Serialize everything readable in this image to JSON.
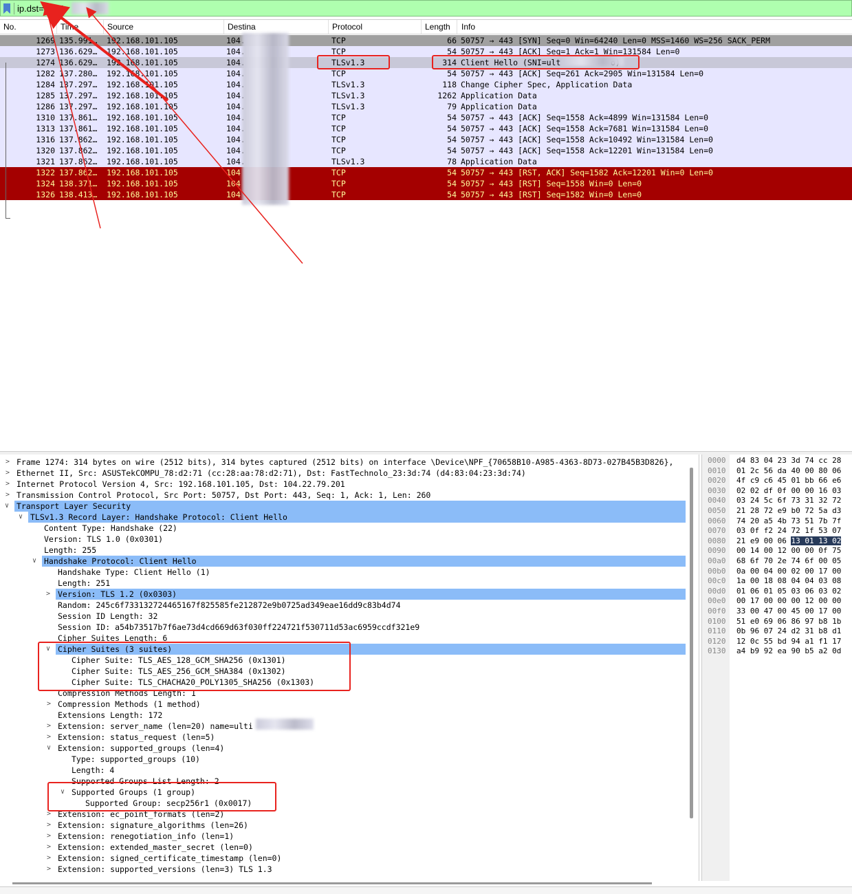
{
  "filter": {
    "text": "ip.dst==104."
  },
  "columns": {
    "no": "No.",
    "time": "Time",
    "source": "Source",
    "destination": "Destina",
    "protocol": "Protocol",
    "length": "Length",
    "info": "Info"
  },
  "packets": [
    {
      "no": "1269",
      "time": "135.991…",
      "src": "192.168.101.105",
      "dst": "104.",
      "proto": "TCP",
      "len": "66",
      "info": "50757 → 443 [SYN] Seq=0 Win=64240 Len=0 MSS=1460 WS=256 SACK_PERM",
      "style": "gray"
    },
    {
      "no": "1273",
      "time": "136.629…",
      "src": "192.168.101.105",
      "dst": "104.",
      "proto": "TCP",
      "len": "54",
      "info": "50757 → 443 [ACK] Seq=1 Ack=1 Win=131584 Len=0",
      "style": "lav"
    },
    {
      "no": "1274",
      "time": "136.629…",
      "src": "192.168.101.105",
      "dst": "104.",
      "proto": "TLSv1.3",
      "len": "314",
      "info": "Client Hello (SNI=ult",
      "info_tail": "o)",
      "style": "sel"
    },
    {
      "no": "1282",
      "time": "137.280…",
      "src": "192.168.101.105",
      "dst": "104.",
      "proto": "TCP",
      "len": "54",
      "info": "50757 → 443 [ACK] Seq=261 Ack=2905 Win=131584 Len=0",
      "style": "lav"
    },
    {
      "no": "1284",
      "time": "137.297…",
      "src": "192.168.101.105",
      "dst": "104.",
      "proto": "TLSv1.3",
      "len": "118",
      "info": "Change Cipher Spec, Application Data",
      "style": "lav"
    },
    {
      "no": "1285",
      "time": "137.297…",
      "src": "192.168.101.105",
      "dst": "104.",
      "proto": "TLSv1.3",
      "len": "1262",
      "info": "Application Data",
      "style": "lav"
    },
    {
      "no": "1286",
      "time": "137.297…",
      "src": "192.168.101.105",
      "dst": "104.",
      "proto": "TLSv1.3",
      "len": "79",
      "info": "Application Data",
      "style": "lav"
    },
    {
      "no": "1310",
      "time": "137.861…",
      "src": "192.168.101.105",
      "dst": "104.",
      "proto": "TCP",
      "len": "54",
      "info": "50757 → 443 [ACK] Seq=1558 Ack=4899 Win=131584 Len=0",
      "style": "lav"
    },
    {
      "no": "1313",
      "time": "137.861…",
      "src": "192.168.101.105",
      "dst": "104.",
      "proto": "TCP",
      "len": "54",
      "info": "50757 → 443 [ACK] Seq=1558 Ack=7681 Win=131584 Len=0",
      "style": "lav"
    },
    {
      "no": "1316",
      "time": "137.862…",
      "src": "192.168.101.105",
      "dst": "104.",
      "proto": "TCP",
      "len": "54",
      "info": "50757 → 443 [ACK] Seq=1558 Ack=10492 Win=131584 Len=0",
      "style": "lav"
    },
    {
      "no": "1320",
      "time": "137.862…",
      "src": "192.168.101.105",
      "dst": "104.",
      "proto": "TCP",
      "len": "54",
      "info": "50757 → 443 [ACK] Seq=1558 Ack=12201 Win=131584 Len=0",
      "style": "lav"
    },
    {
      "no": "1321",
      "time": "137.862…",
      "src": "192.168.101.105",
      "dst": "104.",
      "proto": "TLSv1.3",
      "len": "78",
      "info": "Application Data",
      "style": "lav"
    },
    {
      "no": "1322",
      "time": "137.862…",
      "src": "192.168.101.105",
      "dst": "104",
      "proto": "TCP",
      "len": "54",
      "info": "50757 → 443 [RST, ACK] Seq=1582 Ack=12201 Win=0 Len=0",
      "style": "red"
    },
    {
      "no": "1324",
      "time": "138.371…",
      "src": "192.168.101.105",
      "dst": "104",
      "proto": "TCP",
      "len": "54",
      "info": "50757 → 443 [RST] Seq=1558 Win=0 Len=0",
      "style": "red"
    },
    {
      "no": "1326",
      "time": "138.413…",
      "src": "192.168.101.105",
      "dst": "104",
      "proto": "TCP",
      "len": "54",
      "info": "50757 → 443 [RST] Seq=1582 Win=0 Len=0",
      "style": "red"
    }
  ],
  "details": [
    {
      "t": "Frame 1274: 314 bytes on wire (2512 bits), 314 bytes captured (2512 bits) on interface \\Device\\NPF_{70658B10-A985-4363-8D73-027B45B3D826},",
      "lvl": 0,
      "arrow": "right"
    },
    {
      "t": "Ethernet II, Src: ASUSTekCOMPU_78:d2:71 (cc:28:aa:78:d2:71), Dst: FastTechnolo_23:3d:74 (d4:83:04:23:3d:74)",
      "lvl": 0,
      "arrow": "right"
    },
    {
      "t": "Internet Protocol Version 4, Src: 192.168.101.105, Dst: 104.22.79.201",
      "lvl": 0,
      "arrow": "right"
    },
    {
      "t": "Transmission Control Protocol, Src Port: 50757, Dst Port: 443, Seq: 1, Ack: 1, Len: 260",
      "lvl": 0,
      "arrow": "right"
    },
    {
      "t": "Transport Layer Security",
      "lvl": 0,
      "arrow": "down",
      "hl": true
    },
    {
      "t": "TLSv1.3 Record Layer: Handshake Protocol: Client Hello",
      "lvl": 1,
      "arrow": "down",
      "hl": true
    },
    {
      "t": "Content Type: Handshake (22)",
      "lvl": 2
    },
    {
      "t": "Version: TLS 1.0 (0x0301)",
      "lvl": 2
    },
    {
      "t": "Length: 255",
      "lvl": 2
    },
    {
      "t": "Handshake Protocol: Client Hello",
      "lvl": 2,
      "arrow": "down",
      "hl": true
    },
    {
      "t": "Handshake Type: Client Hello (1)",
      "lvl": 3
    },
    {
      "t": "Length: 251",
      "lvl": 3
    },
    {
      "t": "Version: TLS 1.2 (0x0303)",
      "lvl": 3,
      "arrow": "right",
      "hl": true
    },
    {
      "t": "Random: 245c6f733132724465167f825585fe212872e9b0725ad349eae16dd9c83b4d74",
      "lvl": 3
    },
    {
      "t": "Session ID Length: 32",
      "lvl": 3
    },
    {
      "t": "Session ID: a54b73517b7f6ae73d4cd669d63f030ff224721f530711d53ac6959ccdf321e9",
      "lvl": 3
    },
    {
      "t": "Cipher Suites Length: 6",
      "lvl": 3
    },
    {
      "t": "Cipher Suites (3 suites)",
      "lvl": 3,
      "arrow": "down",
      "hl": true
    },
    {
      "t": "Cipher Suite: TLS_AES_128_GCM_SHA256 (0x1301)",
      "lvl": 4
    },
    {
      "t": "Cipher Suite: TLS_AES_256_GCM_SHA384 (0x1302)",
      "lvl": 4
    },
    {
      "t": "Cipher Suite: TLS_CHACHA20_POLY1305_SHA256 (0x1303)",
      "lvl": 4
    },
    {
      "t": "Compression Methods Length: 1",
      "lvl": 3
    },
    {
      "t": "Compression Methods (1 method)",
      "lvl": 3,
      "arrow": "right"
    },
    {
      "t": "Extensions Length: 172",
      "lvl": 3
    },
    {
      "t": "Extension: server_name (len=20) name=ulti",
      "lvl": 3,
      "arrow": "right"
    },
    {
      "t": "Extension: status_request (len=5)",
      "lvl": 3,
      "arrow": "right"
    },
    {
      "t": "Extension: supported_groups (len=4)",
      "lvl": 3,
      "arrow": "down"
    },
    {
      "t": "Type: supported_groups (10)",
      "lvl": 4
    },
    {
      "t": "Length: 4",
      "lvl": 4
    },
    {
      "t": "Supported Groups List Length: 2",
      "lvl": 4
    },
    {
      "t": "Supported Groups (1 group)",
      "lvl": 4,
      "arrow": "down"
    },
    {
      "t": "Supported Group: secp256r1 (0x0017)",
      "lvl": 5
    },
    {
      "t": "Extension: ec_point_formats (len=2)",
      "lvl": 3,
      "arrow": "right"
    },
    {
      "t": "Extension: signature_algorithms (len=26)",
      "lvl": 3,
      "arrow": "right"
    },
    {
      "t": "Extension: renegotiation_info (len=1)",
      "lvl": 3,
      "arrow": "right"
    },
    {
      "t": "Extension: extended_master_secret (len=0)",
      "lvl": 3,
      "arrow": "right"
    },
    {
      "t": "Extension: signed_certificate_timestamp (len=0)",
      "lvl": 3,
      "arrow": "right"
    },
    {
      "t": "Extension: supported_versions (len=3) TLS 1.3",
      "lvl": 3,
      "arrow": "right"
    }
  ],
  "bytes": [
    {
      "off": "0000",
      "hex": "d4 83 04 23 3d 74 cc 28"
    },
    {
      "off": "0010",
      "hex": "01 2c 56 da 40 00 80 06"
    },
    {
      "off": "0020",
      "hex": "4f c9 c6 45 01 bb 66 e6"
    },
    {
      "off": "0030",
      "hex": "02 02 df 0f 00 00 16 03"
    },
    {
      "off": "0040",
      "hex": "03 24 5c 6f 73 31 32 72"
    },
    {
      "off": "0050",
      "hex": "21 28 72 e9 b0 72 5a d3"
    },
    {
      "off": "0060",
      "hex": "74 20 a5 4b 73 51 7b 7f"
    },
    {
      "off": "0070",
      "hex": "03 0f f2 24 72 1f 53 07"
    },
    {
      "off": "0080",
      "hex": "21 e9 00 06 ",
      "hex_sel": "13 01 13 02"
    },
    {
      "off": "0090",
      "hex": "00 14 00 12 00 00 0f 75"
    },
    {
      "off": "00a0",
      "hex": "68 6f 70 2e 74 6f 00 05"
    },
    {
      "off": "00b0",
      "hex": "0a 00 04 00 02 00 17 00"
    },
    {
      "off": "00c0",
      "hex": "1a 00 18 08 04 04 03 08"
    },
    {
      "off": "00d0",
      "hex": "01 06 01 05 03 06 03 02"
    },
    {
      "off": "00e0",
      "hex": "00 17 00 00 00 12 00 00"
    },
    {
      "off": "00f0",
      "hex": "33 00 47 00 45 00 17 00"
    },
    {
      "off": "0100",
      "hex": "51 e0 69 06 86 97 b8 1b"
    },
    {
      "off": "0110",
      "hex": "0b 96 07 24 d2 31 b8 d1"
    },
    {
      "off": "0120",
      "hex": "12 0c 55 bd 94 a1 f1 17"
    },
    {
      "off": "0130",
      "hex": "a4 b9 92 ea 90 b5 a2 0d"
    }
  ],
  "colors": {
    "annotation": "#e8221e",
    "filter_ok": "#afffaf",
    "rst_row": "#a40000",
    "selected_detail": "#8bbcf8"
  }
}
